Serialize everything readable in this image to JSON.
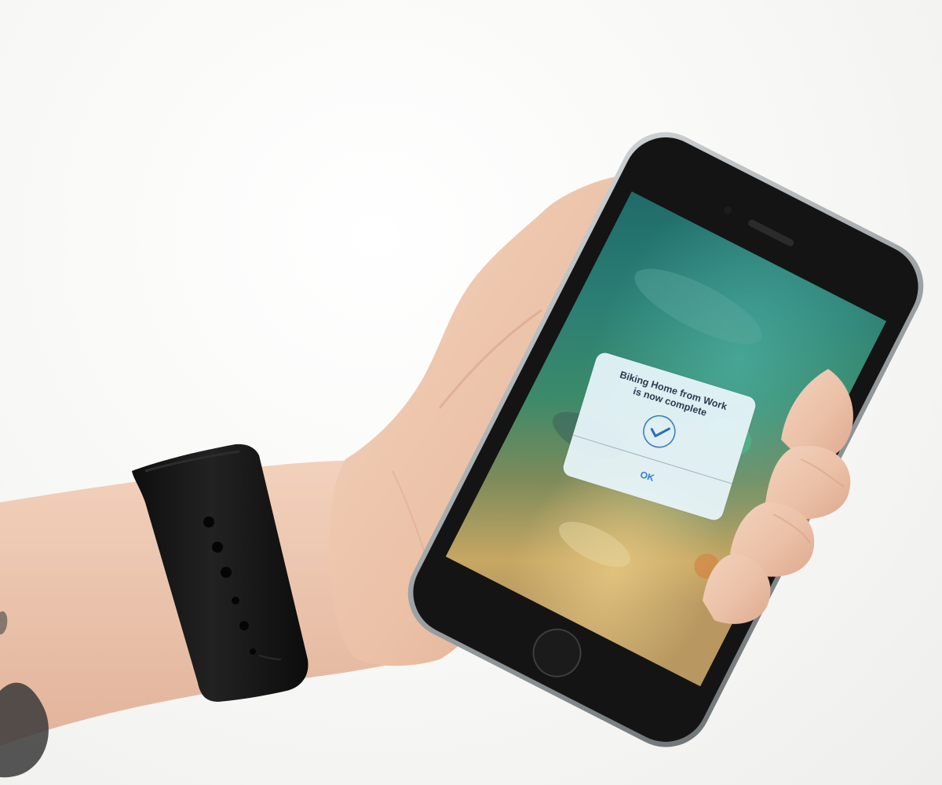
{
  "alert": {
    "title": "Biking Home from Work\nis now complete",
    "confirm_icon": "checkmark-circle-icon",
    "ok_label": "OK"
  },
  "colors": {
    "alert_background": "#e8f4fa",
    "ok_text": "#2b7fd6",
    "phone_body": "#161616",
    "watch_band": "#141414"
  }
}
